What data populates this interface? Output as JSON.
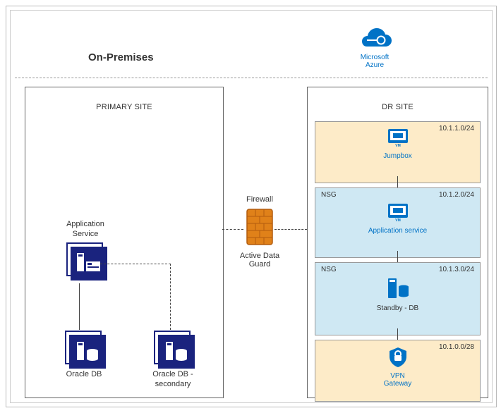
{
  "header": {
    "on_prem_title": "On-Premises",
    "azure_label_line1": "Microsoft",
    "azure_label_line2": "Azure"
  },
  "primary_site": {
    "title": "PRIMARY SITE",
    "app_service_label": "Application\nService",
    "oracle_db_label": "Oracle DB",
    "oracle_db_secondary_label": "Oracle DB -\nsecondary"
  },
  "firewall": {
    "label": "Firewall",
    "adg_label": "Active Data Guard"
  },
  "dr_site": {
    "title": "DR SITE",
    "jumpbox": {
      "ip": "10.1.1.0/24",
      "label": "Jumpbox"
    },
    "app": {
      "tag": "NSG",
      "ip": "10.1.2.0/24",
      "label": "Application service"
    },
    "db": {
      "tag": "NSG",
      "ip": "10.1.3.0/24",
      "label": "Standby - DB"
    },
    "vpn": {
      "ip": "10.1.0.0/28",
      "label_line1": "VPN",
      "label_line2": "Gateway"
    }
  }
}
